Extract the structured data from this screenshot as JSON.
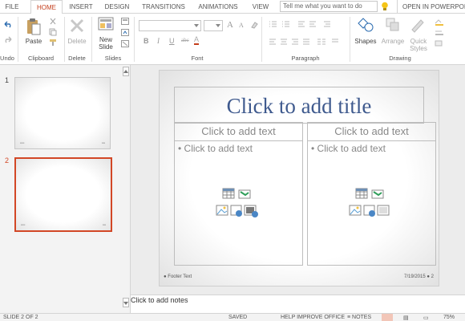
{
  "tabs": [
    {
      "label": "FILE",
      "active": false
    },
    {
      "label": "HOME",
      "active": true
    },
    {
      "label": "INSERT",
      "active": false
    },
    {
      "label": "DESIGN",
      "active": false
    },
    {
      "label": "TRANSITIONS",
      "active": false
    },
    {
      "label": "ANIMATIONS",
      "active": false
    },
    {
      "label": "VIEW",
      "active": false
    }
  ],
  "tell_me": {
    "placeholder": "Tell me what you want to do"
  },
  "open_in": "OPEN IN POWERPOINT",
  "ribbon": {
    "undo_group": "Undo",
    "clipboard": {
      "paste": "Paste",
      "group": "Clipboard"
    },
    "delete": {
      "label": "Delete",
      "group": "Delete"
    },
    "slides": {
      "new_slide_line1": "New",
      "new_slide_line2": "Slide",
      "group": "Slides"
    },
    "font": {
      "group": "Font",
      "bold": "B",
      "italic": "I",
      "underline": "U",
      "strike": "abc",
      "font_color": "A",
      "grow": "A",
      "shrink": "A"
    },
    "paragraph": {
      "group": "Paragraph"
    },
    "drawing": {
      "group": "Drawing",
      "shapes": "Shapes",
      "arrange": "Arrange",
      "quick_styles_line1": "Quick",
      "quick_styles_line2": "Styles"
    }
  },
  "thumbnails": [
    {
      "number": "1",
      "selected": false
    },
    {
      "number": "2",
      "selected": true
    }
  ],
  "slide": {
    "title": "Click to add title",
    "left_heading": "Click to add text",
    "right_heading": "Click to add text",
    "left_body": "Click to add text",
    "right_body": "Click to add text",
    "footer": "Footer Text",
    "date_page": "7/19/2015 ● 2"
  },
  "notes": "Click to add notes",
  "status": {
    "slide_counter": "SLIDE 2 OF 2",
    "saved": "SAVED",
    "help_improve": "HELP IMPROVE OFFICE",
    "notes": "NOTES",
    "zoom": "75%"
  },
  "colors": {
    "accent": "#d24726",
    "title": "#3f5a8e"
  }
}
